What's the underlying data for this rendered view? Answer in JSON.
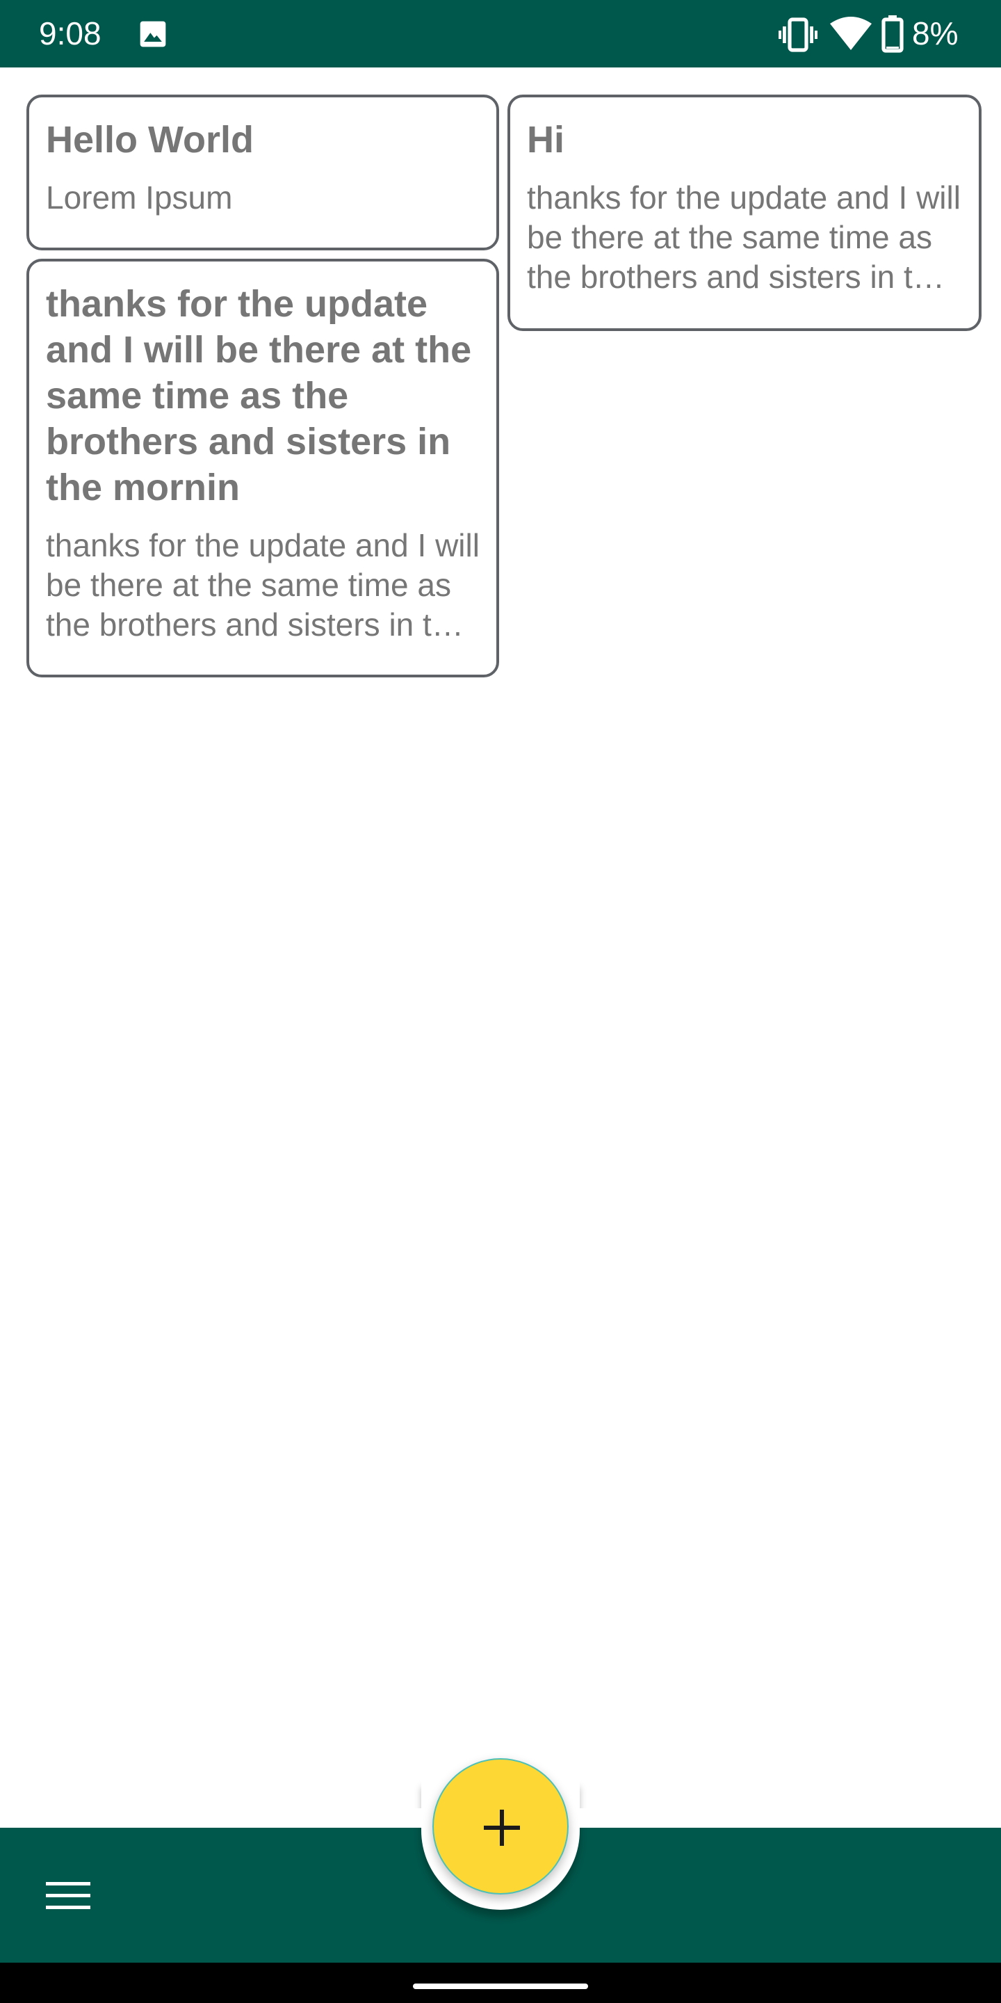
{
  "status_bar": {
    "time": "9:08",
    "battery": "8%",
    "icons": [
      "image-icon",
      "vibrate-icon",
      "wifi-icon",
      "battery-icon"
    ]
  },
  "notes": [
    {
      "title": "Hello World",
      "body": "Lorem Ipsum"
    },
    {
      "title": "Hi",
      "body": "thanks for the update and I will be there at the same time as the brothers and sisters in the mornin"
    },
    {
      "title": "thanks for the update and I will be there at the same time as the brothers and sisters in the mornin",
      "body": "thanks for the update and I will be there at the same time as the brothers and sisters in the mornin"
    }
  ],
  "bottom_bar": {
    "menu_icon": "hamburger-menu-icon",
    "fab_icon": "plus-icon"
  },
  "colors": {
    "primary_dark": "#00574b",
    "fab": "#fdd835",
    "card_border": "#5f6368",
    "card_text": "#767676",
    "background": "#ffffff"
  }
}
